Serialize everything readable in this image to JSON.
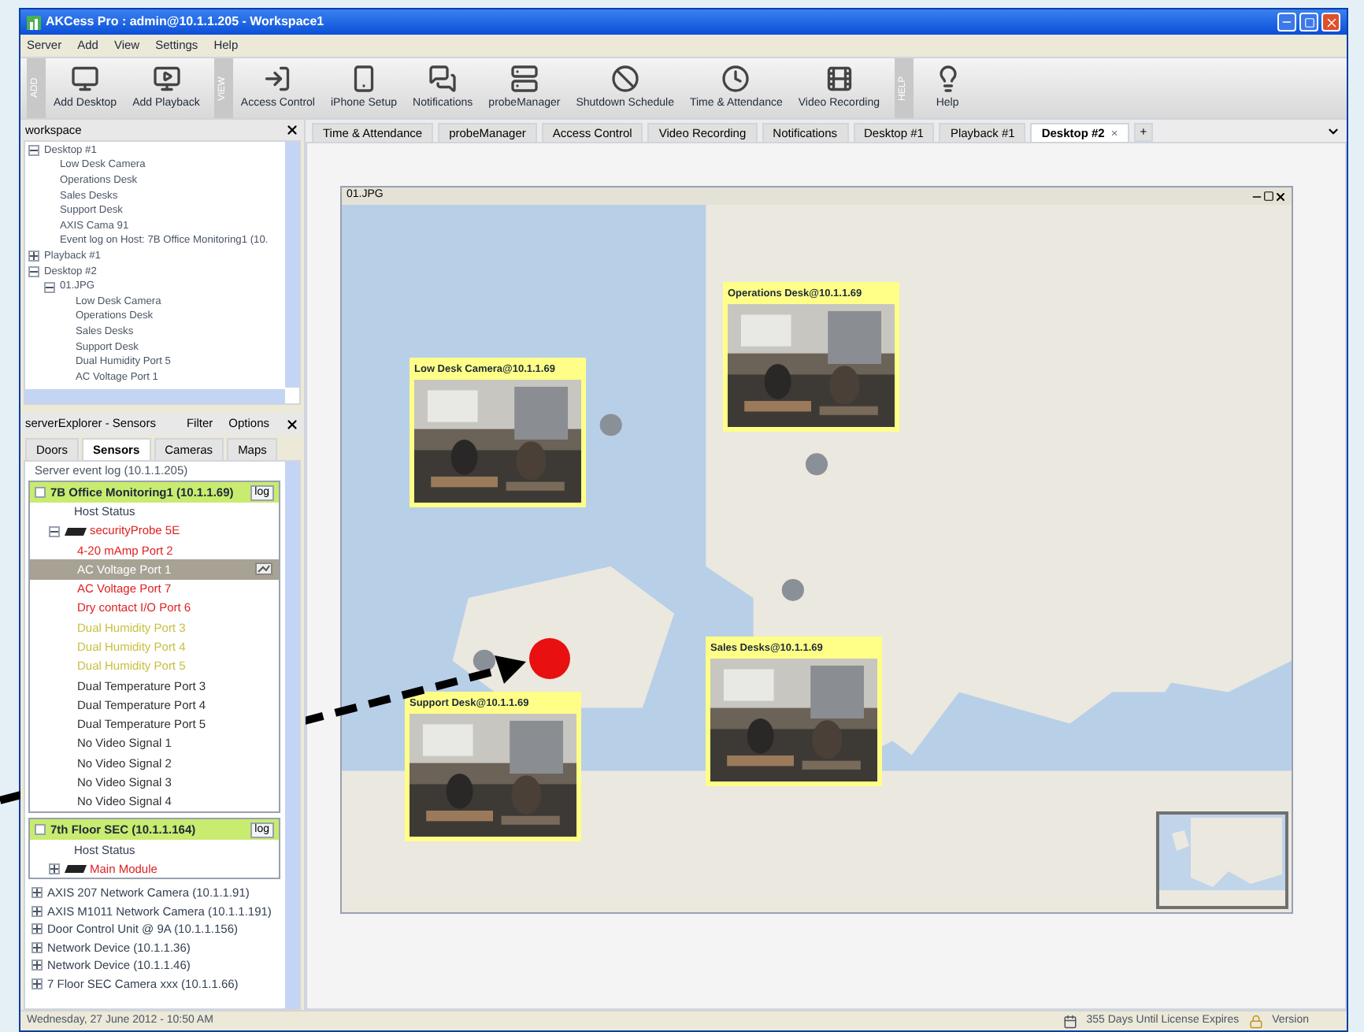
{
  "window": {
    "title": "AKCess Pro : admin@10.1.1.205 - Workspace1"
  },
  "menu": [
    "Server",
    "Add",
    "View",
    "Settings",
    "Help"
  ],
  "toolbar": [
    {
      "group": "ADD",
      "buttons": [
        {
          "label": "Add Desktop",
          "kind": "desktop"
        },
        {
          "label": "Add Playback",
          "kind": "playback"
        }
      ]
    },
    {
      "group": "VIEW",
      "buttons": [
        {
          "label": "Access Control",
          "kind": "door"
        },
        {
          "label": "iPhone Setup",
          "kind": "phone"
        },
        {
          "label": "Notifications",
          "kind": "chat"
        },
        {
          "label": "probeManager",
          "kind": "server"
        },
        {
          "label": "Shutdown Schedule",
          "kind": "ban"
        },
        {
          "label": "Time & Attendance",
          "kind": "clock"
        },
        {
          "label": "Video Recording",
          "kind": "film"
        }
      ]
    },
    {
      "group": "HELP",
      "buttons": [
        {
          "label": "Help",
          "kind": "bulb"
        }
      ]
    }
  ],
  "workspace": {
    "title": "workspace",
    "tree": [
      {
        "label": "Desktop #1",
        "expanded": true,
        "children": [
          {
            "label": "Low Desk Camera"
          },
          {
            "label": "Operations Desk"
          },
          {
            "label": "Sales Desks"
          },
          {
            "label": "Support Desk"
          },
          {
            "label": "AXIS Cama 91"
          },
          {
            "label": "Event log on Host: 7B Office Monitoring1 (10."
          }
        ]
      },
      {
        "label": "Playback #1",
        "expanded": false
      },
      {
        "label": "Desktop #2",
        "expanded": true,
        "children": [
          {
            "label": "01.JPG",
            "expanded": true,
            "children": [
              {
                "label": "Low Desk Camera"
              },
              {
                "label": "Operations Desk"
              },
              {
                "label": "Sales Desks"
              },
              {
                "label": "Support Desk"
              },
              {
                "label": "Dual Humidity Port 5"
              },
              {
                "label": "AC Voltage Port 1"
              }
            ]
          }
        ]
      }
    ]
  },
  "sensors_panel": {
    "title": "serverExplorer - Sensors",
    "filter": "Filter",
    "options": "Options",
    "tabs": [
      {
        "label": "Doors",
        "selected": false
      },
      {
        "label": "Sensors",
        "selected": true
      },
      {
        "label": "Cameras",
        "selected": false
      },
      {
        "label": "Maps",
        "selected": false
      }
    ],
    "event_log": "Server event log (10.1.1.205)",
    "hosts": [
      {
        "name": "7B Office Monitoring1 (10.1.1.69)",
        "log_button": "log",
        "host_status": "Host Status",
        "device": {
          "label": "securityProbe 5E",
          "expanded": true,
          "color": "#e02020",
          "children": [
            {
              "label": "4-20 mAmp Port 2",
              "color": "#e02020",
              "selected": false
            },
            {
              "label": "AC Voltage Port 1",
              "selected": true
            },
            {
              "label": "AC Voltage Port 7",
              "color": "#e02020",
              "selected": false
            },
            {
              "label": "Dry contact I/O Port 6",
              "color": "#e02020",
              "selected": false
            },
            {
              "label": "Dual Humidity Port 3",
              "color": "#c8c040",
              "selected": false
            },
            {
              "label": "Dual Humidity Port 4",
              "color": "#c8c040",
              "selected": false
            },
            {
              "label": "Dual Humidity Port 5",
              "color": "#c8c040",
              "selected": false
            },
            {
              "label": "Dual Temperature Port 3",
              "color": "#303030",
              "selected": false
            },
            {
              "label": "Dual Temperature Port 4",
              "color": "#303030",
              "selected": false
            },
            {
              "label": "Dual Temperature Port 5",
              "color": "#303030",
              "selected": false
            },
            {
              "label": "No Video Signal 1",
              "color": "#303030",
              "selected": false
            },
            {
              "label": "No Video Signal 2",
              "color": "#303030",
              "selected": false
            },
            {
              "label": "No Video Signal 3",
              "color": "#303030",
              "selected": false
            },
            {
              "label": "No Video Signal 4",
              "color": "#303030",
              "selected": false
            }
          ]
        }
      },
      {
        "name": "7th Floor SEC (10.1.1.164)",
        "log_button": "log",
        "host_status": "Host Status",
        "device": {
          "label": "Main Module",
          "expanded": false,
          "color": "#e02020"
        }
      }
    ],
    "devices": [
      "AXIS 207 Network Camera (10.1.1.91)",
      "AXIS M1011 Network Camera (10.1.1.191)",
      "Door Control Unit @ 9A (10.1.1.156)",
      "Network Device (10.1.1.36)",
      "Network Device (10.1.1.46)",
      "7 Floor SEC Camera xxx (10.1.1.66)"
    ]
  },
  "tabs": [
    {
      "label": "Time & Attendance",
      "selected": false
    },
    {
      "label": "probeManager",
      "selected": false
    },
    {
      "label": "Access Control",
      "selected": false
    },
    {
      "label": "Video Recording",
      "selected": false
    },
    {
      "label": "Notifications",
      "selected": false
    },
    {
      "label": "Desktop #1",
      "selected": false
    },
    {
      "label": "Playback #1",
      "selected": false
    },
    {
      "label": "Desktop #2",
      "selected": true,
      "close": "×"
    }
  ],
  "new_tab": "+",
  "map_window": {
    "title": "01.JPG",
    "cameras": [
      {
        "title": "Low Desk Camera@10.1.1.69"
      },
      {
        "title": "Operations Desk@10.1.1.69"
      },
      {
        "title": "Sales Desks@10.1.1.69"
      },
      {
        "title": "Support Desk@10.1.1.69"
      }
    ]
  },
  "status_bar": {
    "datetime": "Wednesday, 27 June 2012 - 10:50 AM",
    "license": "355 Days Until License Expires",
    "version": "Version"
  }
}
